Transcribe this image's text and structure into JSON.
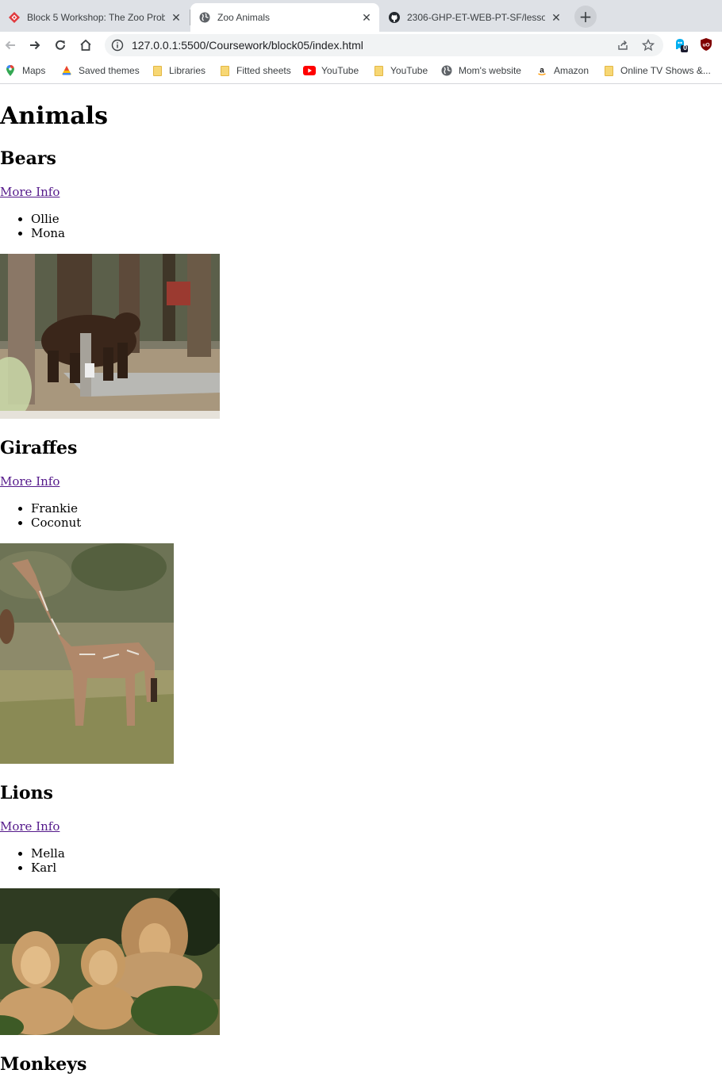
{
  "browser": {
    "tabs": [
      {
        "title": "Block 5 Workshop: The Zoo Prob",
        "favicon": "fullstack-logo-icon",
        "active": false
      },
      {
        "title": "Zoo Animals",
        "favicon": "globe-icon",
        "active": true
      },
      {
        "title": "2306-GHP-ET-WEB-PT-SF/lesson",
        "favicon": "github-icon",
        "active": false
      }
    ],
    "tab_close_glyph": "✕",
    "new_tab_glyph": "+",
    "url": "127.0.0.1:5500/Coursework/block05/index.html",
    "extension_badge": "0",
    "bookmarks": [
      {
        "label": "Maps",
        "icon": "maps-icon"
      },
      {
        "label": "Saved themes",
        "icon": "themes-icon"
      },
      {
        "label": "Libraries",
        "icon": "folder-icon"
      },
      {
        "label": "Fitted sheets",
        "icon": "folder-icon"
      },
      {
        "label": "YouTube",
        "icon": "youtube-icon"
      },
      {
        "label": "YouTube",
        "icon": "folder-icon"
      },
      {
        "label": "Mom's website",
        "icon": "globe-icon"
      },
      {
        "label": "Amazon",
        "icon": "amazon-icon"
      },
      {
        "label": "Online TV Shows &...",
        "icon": "folder-icon"
      }
    ]
  },
  "page": {
    "heading": "Animals",
    "sections": [
      {
        "title": "Bears",
        "link": "More Info",
        "names": [
          "Ollie",
          "Mona"
        ],
        "image": "brown bear walking past a post among pine trees"
      },
      {
        "title": "Giraffes",
        "link": "More Info",
        "names": [
          "Frankie",
          "Coconut"
        ],
        "image": "giraffe standing in tall grass"
      },
      {
        "title": "Lions",
        "link": "More Info",
        "names": [
          "Mella",
          "Karl"
        ],
        "image": "three lions resting in grass"
      },
      {
        "title": "Monkeys"
      }
    ]
  },
  "colors": {
    "tabstrip": "#dee1e6",
    "link_visited": "#551a8b",
    "omnibox": "#f1f3f4"
  }
}
